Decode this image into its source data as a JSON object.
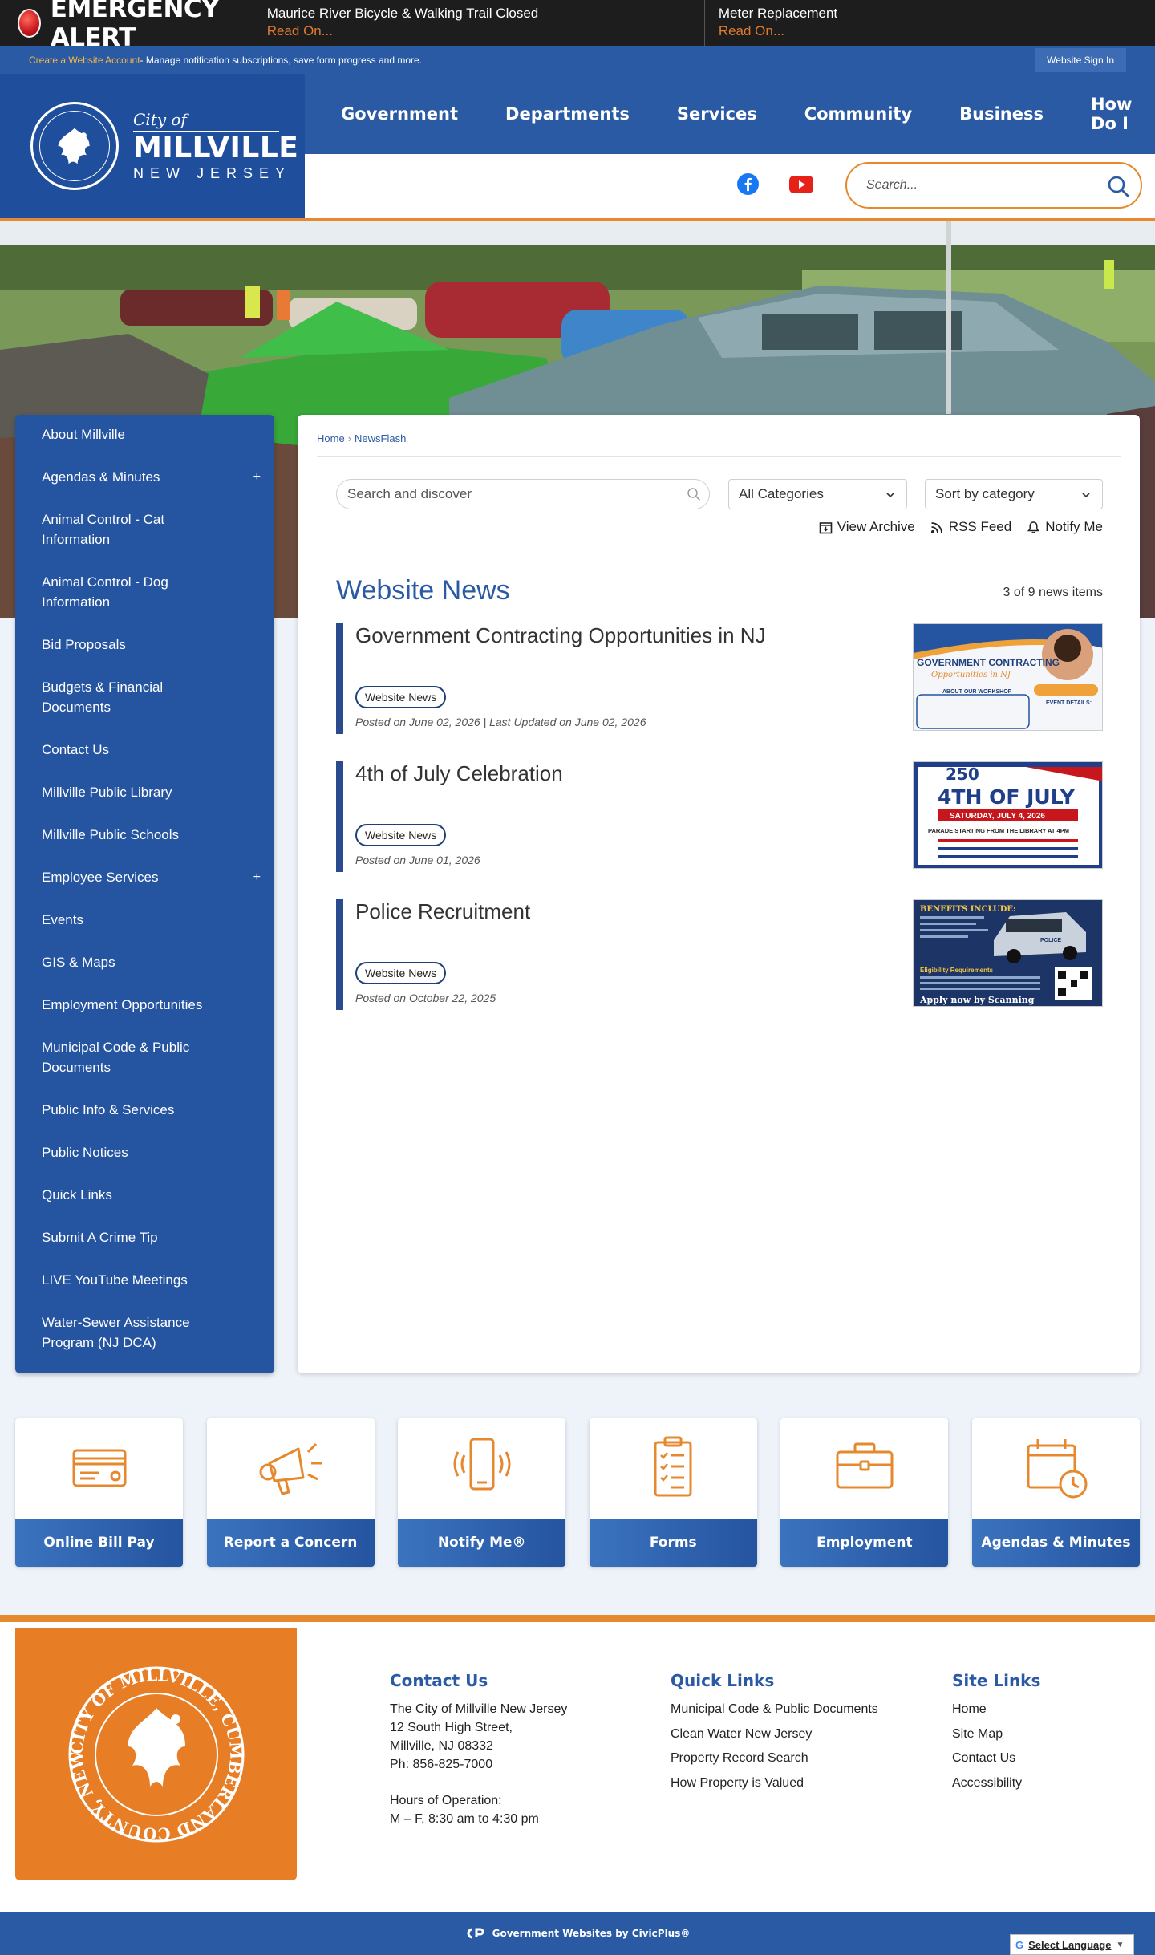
{
  "alert": {
    "title": "EMERGENCY ALERT",
    "items": [
      {
        "headline": "Maurice River Bicycle & Walking Trail Closed",
        "link": "Read On..."
      },
      {
        "headline": "Meter Replacement",
        "link": "Read On..."
      }
    ]
  },
  "account": {
    "create_link": "Create a Website Account",
    "description": " - Manage notification subscriptions, save form progress and more.",
    "signin": "Website Sign In"
  },
  "logo": {
    "city_of": "City of",
    "name": "MILLVILLE",
    "state": "NEW JERSEY"
  },
  "nav": [
    "Government",
    "Departments",
    "Services",
    "Community",
    "Business",
    "How Do I"
  ],
  "search": {
    "placeholder": "Search..."
  },
  "sidebar": {
    "items": [
      {
        "label": "About Millville",
        "expandable": false
      },
      {
        "label": "Agendas & Minutes",
        "expandable": true
      },
      {
        "label": "Animal Control - Cat Information",
        "expandable": false
      },
      {
        "label": "Animal Control - Dog Information",
        "expandable": false
      },
      {
        "label": "Bid Proposals",
        "expandable": false
      },
      {
        "label": "Budgets & Financial Documents",
        "expandable": false
      },
      {
        "label": "Contact Us",
        "expandable": false
      },
      {
        "label": "Millville Public Library",
        "expandable": false
      },
      {
        "label": "Millville Public Schools",
        "expandable": false
      },
      {
        "label": "Employee Services",
        "expandable": true
      },
      {
        "label": "Events",
        "expandable": false
      },
      {
        "label": "GIS & Maps",
        "expandable": false
      },
      {
        "label": "Employment Opportunities",
        "expandable": false
      },
      {
        "label": "Municipal Code & Public Documents",
        "expandable": false
      },
      {
        "label": "Public Info & Services",
        "expandable": false
      },
      {
        "label": "Public Notices",
        "expandable": false
      },
      {
        "label": "Quick Links",
        "expandable": false
      },
      {
        "label": "Submit A Crime Tip",
        "expandable": false
      },
      {
        "label": "LIVE YouTube Meetings",
        "expandable": false
      },
      {
        "label": "Water-Sewer Assistance Program (NJ DCA)",
        "expandable": false
      }
    ],
    "plus_symbol": "+"
  },
  "breadcrumb": {
    "home": "Home",
    "sep": "›",
    "current": "NewsFlash"
  },
  "filters": {
    "discover_placeholder": "Search and discover",
    "category": "All Categories",
    "sort": "Sort by category"
  },
  "toolbar": {
    "archive": "View Archive",
    "rss": "RSS Feed",
    "notify": "Notify Me"
  },
  "news": {
    "heading": "Website News",
    "count": "3 of 9 news items",
    "items": [
      {
        "title": "Government Contracting Opportunities in NJ",
        "tag": "Website News",
        "posted": "Posted on June 02, 2026 | Last Updated on June 02, 2026",
        "thumb": {
          "line1": "GOVERNMENT CONTRACTING",
          "line2": "Opportunities in NJ",
          "line3": "ABOUT OUR WORKSHOP",
          "line4": "EVENT DETAILS:"
        }
      },
      {
        "title": "4th of July Celebration",
        "tag": "Website News",
        "posted": "Posted on June 01, 2026",
        "thumb": {
          "line1": "250",
          "line2": "4TH OF JULY",
          "line3": "SATURDAY, JULY 4, 2026",
          "line4": "PARADE STARTING FROM THE LIBRARY AT 4PM"
        }
      },
      {
        "title": "Police Recruitment",
        "tag": "Website News",
        "posted": "Posted on October 22, 2025",
        "thumb": {
          "line1": "BENEFITS INCLUDE:",
          "line2": "Eligibility Requirements",
          "line3": "Apply now by Scanning",
          "line4": "POLICE"
        }
      }
    ]
  },
  "tiles": [
    {
      "label": "Online Bill Pay",
      "icon": "credit-card-icon"
    },
    {
      "label": "Report a Concern",
      "icon": "megaphone-icon"
    },
    {
      "label": "Notify Me®",
      "icon": "phone-notify-icon"
    },
    {
      "label": "Forms",
      "icon": "clipboard-icon"
    },
    {
      "label": "Employment",
      "icon": "briefcase-icon"
    },
    {
      "label": "Agendas & Minutes",
      "icon": "calendar-clock-icon"
    }
  ],
  "footer": {
    "contact": {
      "heading": "Contact Us",
      "lines": [
        "The City of Millville New Jersey",
        "12 South High Street,",
        "Millville, NJ 08332",
        "Ph: 856-825-7000"
      ],
      "hours_label": "Hours of Operation:",
      "hours": "M – F, 8:30 am to 4:30 pm"
    },
    "quick_links": {
      "heading": "Quick Links",
      "links": [
        "Municipal Code & Public Documents",
        "Clean Water New Jersey",
        "Property Record Search",
        "How Property is Valued"
      ]
    },
    "site_links": {
      "heading": "Site Links",
      "links": [
        "Home",
        "Site Map",
        "Contact Us",
        "Accessibility"
      ]
    },
    "seal_text": "CITY OF MILLVILLE, CUMBERLAND COUNTY, NEW JERSEY"
  },
  "bottom": {
    "credit": "Government Websites by CivicPlus®",
    "translate": "Select Language",
    "translate_arrow": "▼"
  },
  "colors": {
    "brand_blue": "#2b5aa5",
    "accent_orange": "#e6892e",
    "alert_red": "#c8161d"
  }
}
